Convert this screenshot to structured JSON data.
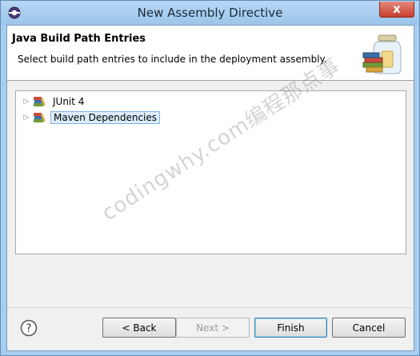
{
  "window": {
    "title": "New Assembly Directive",
    "close_glyph": "x"
  },
  "header": {
    "title": "Java Build Path Entries",
    "description": "Select build path entries to include in the deployment assembly.",
    "icon": "jar-library-icon"
  },
  "tree": {
    "items": [
      {
        "label": "JUnit 4",
        "icon": "library-icon",
        "expanded": false,
        "selected": false
      },
      {
        "label": "Maven Dependencies",
        "icon": "library-icon",
        "expanded": false,
        "selected": true
      }
    ]
  },
  "watermark": "codingwhy.com编程那点事",
  "buttons": {
    "help": "?",
    "back": "< Back",
    "next": "Next >",
    "finish": "Finish",
    "cancel": "Cancel"
  },
  "colors": {
    "title_bar": "#a9cdef",
    "close": "#c7402e",
    "selection": "#dcecfb"
  }
}
